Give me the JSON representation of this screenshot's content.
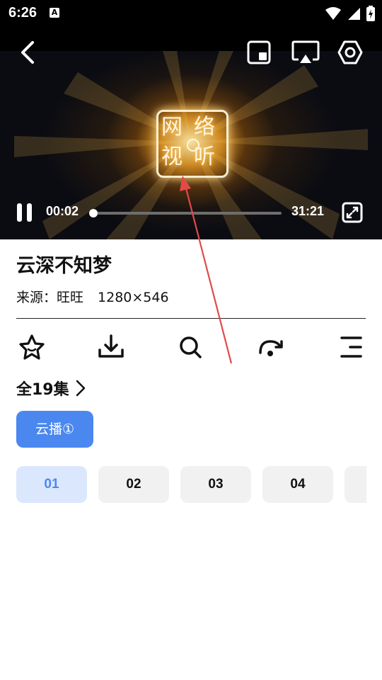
{
  "status": {
    "time": "6:26",
    "notif_icon": "A"
  },
  "player": {
    "current_time": "00:02",
    "total_time": "31:21",
    "progress": 0.001,
    "logo": {
      "chars": [
        "网",
        "络",
        "视",
        "听"
      ]
    }
  },
  "video": {
    "title": "云深不知梦",
    "source": "来源：旺旺",
    "resolution": "1280×546"
  },
  "actions": [
    "star-icon",
    "download-icon",
    "search-icon",
    "cast-next-icon",
    "menu-list-icon"
  ],
  "episodes": {
    "header": "全19集",
    "source_tab": "云播①",
    "items": [
      "01",
      "02",
      "03",
      "04",
      ""
    ]
  },
  "colors": {
    "accent": "#4a88f0",
    "accent_light": "#dbe7fd",
    "arrow": "#e24a4a"
  }
}
